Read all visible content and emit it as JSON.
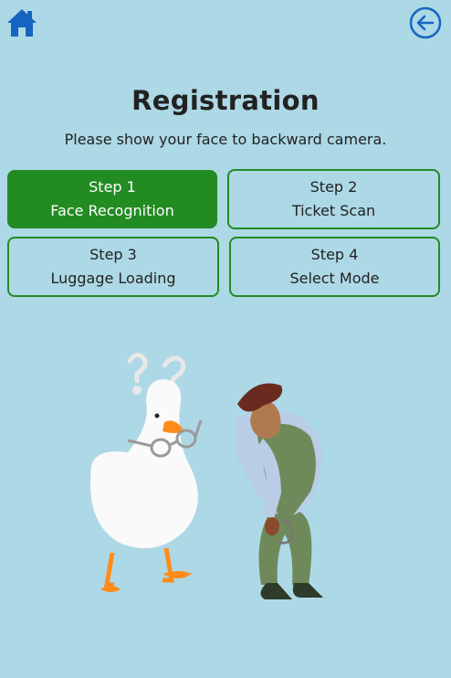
{
  "header": {
    "home_icon": "home-icon",
    "back_icon": "arrow-left-circle-icon"
  },
  "page": {
    "title": "Registration",
    "instruction": "Please show your face to backward camera."
  },
  "steps": [
    {
      "step": "Step 1",
      "label": "Face Recognition",
      "active": true
    },
    {
      "step": "Step 2",
      "label": "Ticket Scan",
      "active": false
    },
    {
      "step": "Step 3",
      "label": "Luggage Loading",
      "active": false
    },
    {
      "step": "Step 4",
      "label": "Select Mode",
      "active": false
    }
  ],
  "colors": {
    "background": "#add8e6",
    "accent": "#228b22",
    "icon": "#1565c0"
  }
}
